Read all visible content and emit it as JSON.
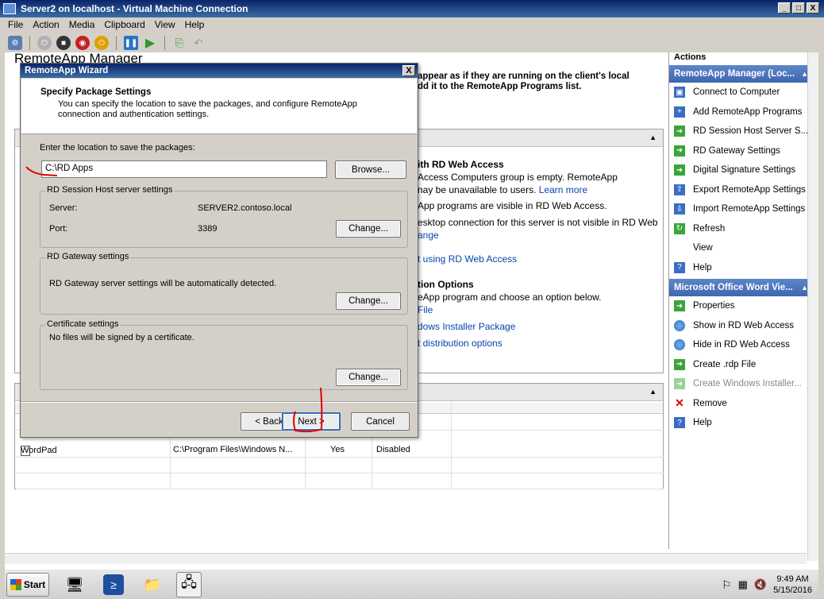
{
  "vm_window": {
    "title": "Server2 on localhost - Virtual Machine Connection",
    "controls": [
      "_",
      "□",
      "X"
    ]
  },
  "vm_menu": [
    "File",
    "Action",
    "Media",
    "Clipboard",
    "View",
    "Help"
  ],
  "mmc": {
    "title_partial": "RemoteApp Manager",
    "overview_text_1": "appear as if they are running on the client's local",
    "overview_text_2": "dd it to the RemoteApp Programs list.",
    "web_access_heading": "ith RD Web Access",
    "web_line_1": " Access Computers group is empty. RemoteApp",
    "web_line_2": "nay be unavailable to users.",
    "web_learn_more": "Learn more",
    "web_line_3": "App programs are visible in RD Web Access.",
    "web_line_4": "esktop connection for this server is not visible in RD Web",
    "web_link_change": "ange",
    "web_link_using": "t using RD Web Access",
    "dist_heading": "tion Options",
    "dist_line_1": "eApp program and choose an option below.",
    "dist_link_file": "File",
    "dist_link_msi": "dows Installer Package",
    "dist_link_options": "t distribution options",
    "grid_row": {
      "name": "WordPad",
      "path": "C:\\Program Files\\Windows N...",
      "visible": "Yes",
      "command_line": "Disabled"
    }
  },
  "actions": {
    "header": "Actions",
    "group1": "RemoteApp Manager (Loc...",
    "group1_items": [
      {
        "label": "Connect to Computer",
        "icon": "connect-computer-icon"
      },
      {
        "label": "Add RemoteApp Programs",
        "icon": "add-programs-icon"
      },
      {
        "label": "RD Session Host Server S...",
        "icon": "green-arrow-icon"
      },
      {
        "label": "RD Gateway Settings",
        "icon": "green-arrow-icon"
      },
      {
        "label": "Digital Signature Settings",
        "icon": "green-arrow-icon"
      },
      {
        "label": "Export RemoteApp Settings",
        "icon": "export-icon"
      },
      {
        "label": "Import RemoteApp Settings",
        "icon": "import-icon"
      },
      {
        "label": "Refresh",
        "icon": "refresh-icon"
      },
      {
        "label": "View",
        "icon": "none"
      },
      {
        "label": "Help",
        "icon": "help-icon"
      }
    ],
    "group2": "Microsoft Office Word Vie...",
    "group2_items": [
      {
        "label": "Properties",
        "icon": "green-arrow-icon"
      },
      {
        "label": "Show in RD Web Access",
        "icon": "globe-icon"
      },
      {
        "label": "Hide in RD Web Access",
        "icon": "globe-icon"
      },
      {
        "label": "Create .rdp File",
        "icon": "green-arrow-icon"
      },
      {
        "label": "Create Windows Installer...",
        "icon": "green-arrow-icon",
        "disabled": true
      },
      {
        "label": "Remove",
        "icon": "remove-icon"
      },
      {
        "label": "Help",
        "icon": "help-icon"
      }
    ]
  },
  "dialog": {
    "title": "RemoteApp Wizard",
    "close": "X",
    "heading": "Specify Package Settings",
    "subheading": "You can specify the location to save the packages, and configure RemoteApp connection and authentication settings.",
    "location_label": "Enter the location to save the packages:",
    "location_value": "C:\\RD Apps",
    "browse_button": "Browse...",
    "session_group": "RD Session Host server settings",
    "server_label": "Server:",
    "server_value": "SERVER2.contoso.local",
    "port_label": "Port:",
    "port_value": "3389",
    "change_button": "Change...",
    "gateway_group": "RD Gateway settings",
    "gateway_text": "RD Gateway server settings will be automatically detected.",
    "cert_group": "Certificate settings",
    "cert_text": "No files will be signed by a certificate.",
    "back_button": "< Back",
    "next_button": "Next >",
    "cancel_button": "Cancel"
  },
  "taskbar": {
    "start": "Start",
    "time": "9:49 AM",
    "date": "5/15/2016"
  }
}
